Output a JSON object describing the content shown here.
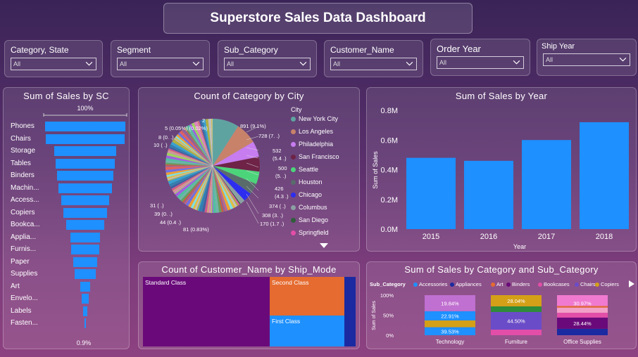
{
  "title": "Superstore Sales Data Dashboard",
  "slicers": [
    {
      "label": "Category, State",
      "value": "All"
    },
    {
      "label": "Segment",
      "value": "All"
    },
    {
      "label": "Sub_Category",
      "value": "All"
    },
    {
      "label": "Customer_Name",
      "value": "All"
    },
    {
      "label": "Order Year",
      "value": "All"
    },
    {
      "label": "Ship Year",
      "value": "All"
    }
  ],
  "funnel": {
    "title": "Sum of Sales by SC",
    "top_pct": "100%",
    "bottom_pct": "0.9%",
    "items": [
      "Phones",
      "Chairs",
      "Storage",
      "Tables",
      "Binders",
      "Machin...",
      "Access...",
      "Copiers",
      "Bookca...",
      "Applia...",
      "Furnis...",
      "Paper",
      "Supplies",
      "Art",
      "Envelo...",
      "Labels",
      "Fasten..."
    ],
    "values": [
      100,
      99,
      77,
      73,
      71,
      67,
      60,
      54,
      47,
      37,
      35,
      30,
      26,
      13,
      9,
      6,
      0.9
    ]
  },
  "pie": {
    "title": "Count of Category by City",
    "legend_title": "City",
    "legend": [
      {
        "name": "New York City",
        "color": "#5fa3a0"
      },
      {
        "name": "Los Angeles",
        "color": "#c8826a"
      },
      {
        "name": "Philadelphia",
        "color": "#c77cf0"
      },
      {
        "name": "San Francisco",
        "color": "#6e2347"
      },
      {
        "name": "Seattle",
        "color": "#4cd47a"
      },
      {
        "name": "Houston",
        "color": "#5a6b6c"
      },
      {
        "name": "Chicago",
        "color": "#2d2df0"
      },
      {
        "name": "Columbus",
        "color": "#8ba0a3"
      },
      {
        "name": "San Diego",
        "color": "#2f5e3c"
      },
      {
        "name": "Springfield",
        "color": "#e24ea8"
      }
    ],
    "labels_right": [
      "891 (9.1%)",
      "728 (7. .)",
      "532",
      "(5.4 .)",
      "500",
      "(5. .)",
      "426",
      "(4.3 .)",
      "374 ( .)",
      "308 (3. .)",
      "170 (1.7 .)"
    ],
    "labels_left": [
      "2",
      "5 (0.05%) (0.02%)",
      "8 (0. .)",
      "10 ( .)",
      "31 ( .)",
      "39 (0. .)",
      "44 (0.4 .)",
      "81 (0.83%)"
    ]
  },
  "bar": {
    "title": "Sum of Sales by Year",
    "ylabel": "Sum of Sales",
    "xlabel": "Year",
    "color": "#1e90ff"
  },
  "chart_data": {
    "type": "bar",
    "title": "Sum of Sales by Year",
    "categories": [
      "2015",
      "2016",
      "2017",
      "2018"
    ],
    "values": [
      0.48,
      0.46,
      0.6,
      0.72
    ],
    "value_unit": "M",
    "xlabel": "Year",
    "ylabel": "Sum of Sales",
    "ylim": [
      0,
      0.8
    ],
    "yticks": [
      "0.0M",
      "0.2M",
      "0.4M",
      "0.6M",
      "0.8M"
    ]
  },
  "treemap": {
    "title": "Count of Customer_Name by Ship_Mode",
    "cells": [
      {
        "name": "Standard Class",
        "color": "#6a0a7a"
      },
      {
        "name": "Second Class",
        "color": "#e56b30"
      },
      {
        "name": "First Class",
        "color": "#1e90ff"
      },
      {
        "name": "",
        "color": "#1b2aa0"
      }
    ]
  },
  "stacked": {
    "title": "Sum of Sales by Category and Sub_Category",
    "legend_title": "Sub_Category",
    "legend": [
      {
        "name": "Accessories",
        "color": "#1e90ff"
      },
      {
        "name": "Appliances",
        "color": "#1b2aa0"
      },
      {
        "name": "Art",
        "color": "#e56b30"
      },
      {
        "name": "Binders",
        "color": "#6a0a7a"
      },
      {
        "name": "Bookcases",
        "color": "#e24ea8"
      },
      {
        "name": "Chairs",
        "color": "#6a4cc8"
      },
      {
        "name": "Copiers",
        "color": "#d4a017"
      }
    ],
    "ylabel": "Sum of Sales",
    "yticks": [
      "100%",
      "50%",
      "0%"
    ],
    "categories": [
      "Technology",
      "Furniture",
      "Office Supplies"
    ],
    "labels": {
      "tech": [
        "39.53%",
        "22.91%",
        "19.84%"
      ],
      "furn": [
        "28.04%",
        "44.50%"
      ],
      "office": [
        "30.97%",
        "28.44%"
      ]
    }
  }
}
